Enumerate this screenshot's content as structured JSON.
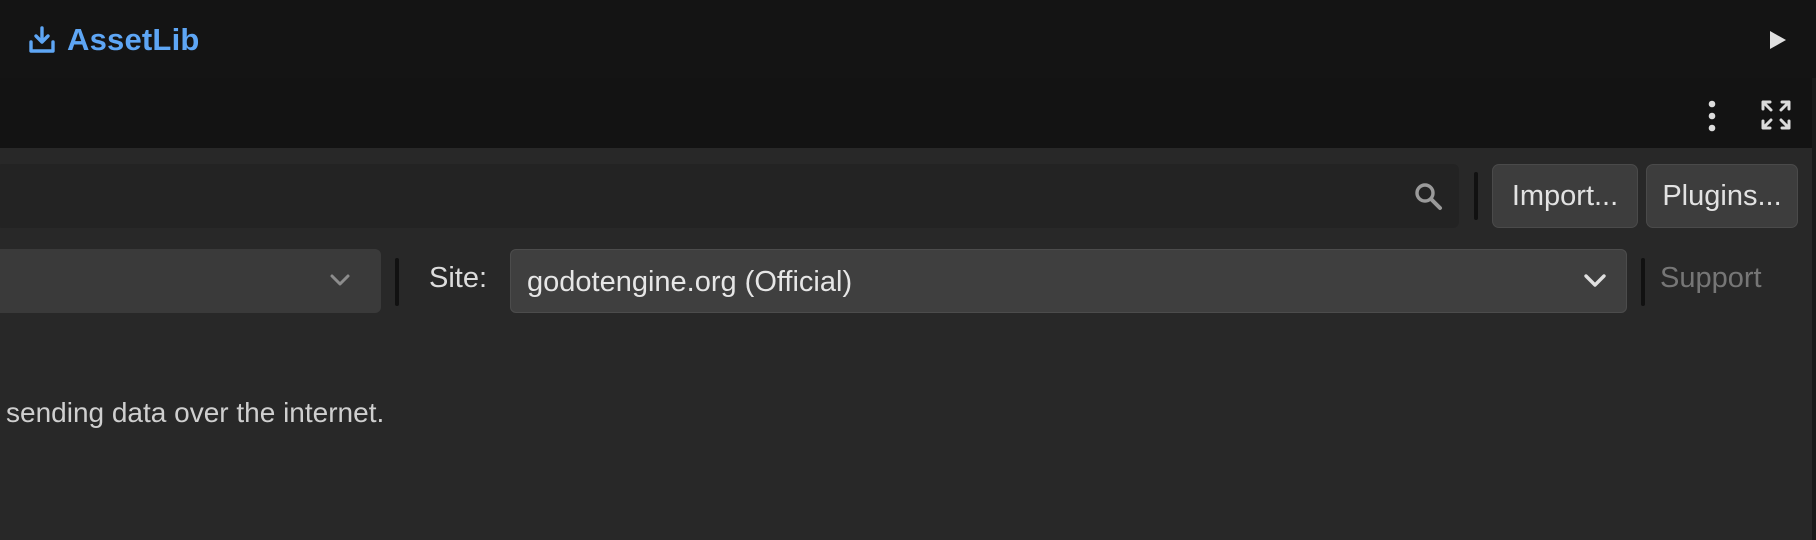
{
  "header": {
    "active_tab": "AssetLib",
    "colors": {
      "accent": "#5ea6f5"
    }
  },
  "toolbar": {
    "play_icon": "play-icon",
    "menu_icon": "kebab-menu-icon",
    "fullscreen_icon": "fullscreen-icon"
  },
  "search": {
    "value": "",
    "placeholder": "",
    "icon": "search-icon"
  },
  "actions": {
    "import_label": "Import...",
    "plugins_label": "Plugins..."
  },
  "filters": {
    "left_dropdown_value": "",
    "site_label": "Site:",
    "site_value": "godotengine.org (Official)",
    "support_label": "Support"
  },
  "notice": {
    "text": "sending data over the internet."
  }
}
